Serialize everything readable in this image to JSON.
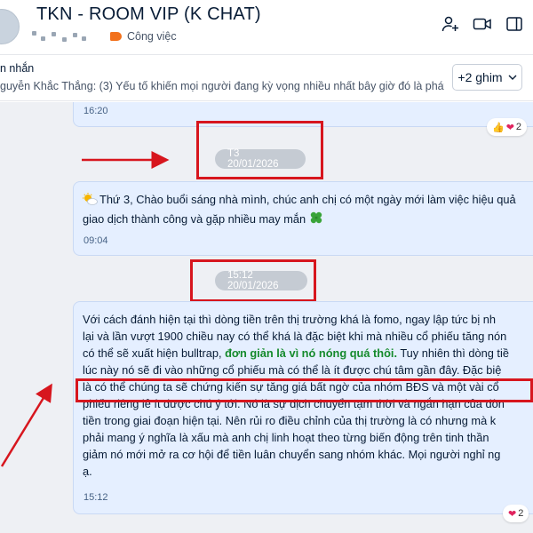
{
  "header": {
    "title": "TKN - ROOM VIP (K CHAT)",
    "tag": "Công việc",
    "tag_color": "#f2711c",
    "icons": [
      "add-member-icon",
      "video-call-icon",
      "sidebar-toggle-icon"
    ]
  },
  "pinned": {
    "title": "n nhắn",
    "text": "guyễn Khắc Thắng: (3) Yếu tố khiến mọi người đang kỳ vọng nhiều nhất bây giờ đó là phát triể...",
    "button_label": "+2 ghim"
  },
  "messages": [
    {
      "time": "16:20",
      "reactions": "2"
    },
    {
      "date": "T3 20/01/2026",
      "text": "Thứ 3, Chào buổi sáng nhà mình, chúc anh chị có một ngày mới làm việc hiệu quả",
      "text2": "giao dịch thành công và gặp nhiều may mắn",
      "time": "09:04"
    },
    {
      "date": "15:12 20/01/2026",
      "lines": [
        "Với cách đánh hiện tại thì dòng tiền trên thị trường khá là fomo, ngay lập tức bị nh",
        "lại và lần vượt 1900 chiều nay có thể khá là đặc biệt khi mà nhiều cổ phiếu tăng nón",
        "có thể sẽ xuất hiện bulltrap,",
        "đơn giản là vì nó nóng quá thôi.",
        "Tuy nhiên thì dòng tiề",
        "lúc này nó sẽ đi vào những cổ phiếu mà có thể là ít được chú tâm gần đây. Đặc biệ",
        "là có thể chúng ta sẽ chứng kiến sự tăng giá bất ngờ của nhóm BĐS và một vài cổ",
        "phiếu riêng lẻ ít được chú ý tới. Nó là sự dịch chuyển tạm thời và ngắn hạn của dòn",
        "tiền trong giai đoạn hiện tại. Nên rủi ro điều chỉnh của thị trường là có nhưng mà k",
        "phải mang ý nghĩa là xấu mà anh chị linh hoạt theo từng biến động trên tinh thần",
        "giảm nó mới mở ra cơ hội để tiền luân chuyển sang nhóm khác. Mọi người nghỉ ng",
        "ạ."
      ],
      "time": "15:12",
      "reactions": "2"
    }
  ]
}
